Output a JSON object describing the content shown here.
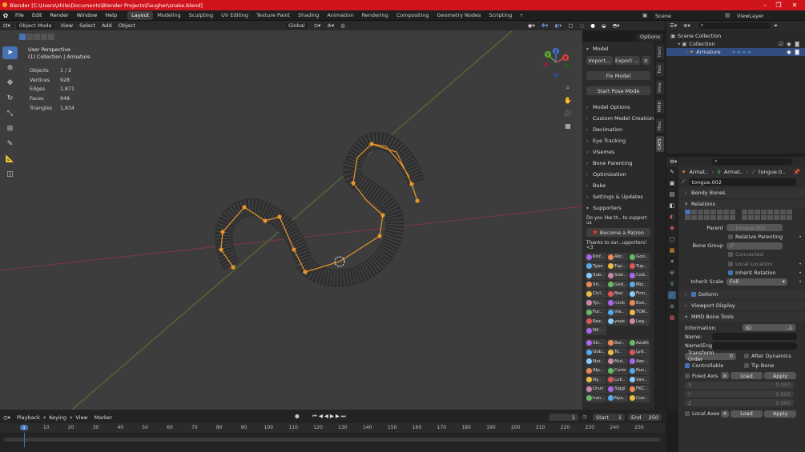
{
  "app": {
    "title": "Blender [C:\\Users\\zhile\\Documents\\Blender Projects\\Faugher\\snake.blend]"
  },
  "menu": [
    "File",
    "Edit",
    "Render",
    "Window",
    "Help"
  ],
  "workspaces": [
    "Layout",
    "Modeling",
    "Sculpting",
    "UV Editing",
    "Texture Paint",
    "Shading",
    "Animation",
    "Rendering",
    "Compositing",
    "Geometry Nodes",
    "Scripting"
  ],
  "active_workspace": "Layout",
  "scene": "Scene",
  "view_layer": "ViewLayer",
  "viewport": {
    "mode": "Object Mode",
    "menus": [
      "View",
      "Select",
      "Add",
      "Object"
    ],
    "orientation": "Global",
    "options": "Options",
    "title": "User Perspective",
    "context": "(1) Collection | Armature",
    "stats": [
      {
        "k": "Objects",
        "v": "1 / 2"
      },
      {
        "k": "Vertices",
        "v": "928"
      },
      {
        "k": "Edges",
        "v": "1,871"
      },
      {
        "k": "Faces",
        "v": "948"
      },
      {
        "k": "Triangles",
        "v": "1,834"
      }
    ]
  },
  "gizmo": {
    "x": "X",
    "y": "Y",
    "z": "Z"
  },
  "npanel": {
    "model_header": "Model",
    "import": "Import...",
    "export": "Export ...",
    "fix_model": "Fix Model",
    "start_pose": "Start Pose Mode",
    "sections": [
      "Model Options",
      "Custom Model Creation",
      "Decimation",
      "Eye Tracking",
      "Visemes",
      "Bone Parenting",
      "Optimization",
      "Bake",
      "Settings & Updates"
    ],
    "supporters_header": "Supporters",
    "support_text": "Do you like th.. to support us",
    "patron": "Become a Patron",
    "thanks": "Thanks to our...upporters! <3",
    "supporters1": [
      "Kric..",
      "Abr..",
      "Goo..",
      "Typo",
      "Tup..",
      "Tup..",
      "Sub..",
      "Sret..",
      "Cod..",
      "Sri..",
      "God..",
      "Miz..",
      "Cicl..",
      "Bee",
      "Finn..",
      "Tyr..",
      "n1ck",
      "Eve..",
      "Fur..",
      "Via..",
      "TOR..",
      "Rez..",
      "yeas",
      "Leg..",
      "Nil.."
    ],
    "supporters2": [
      "Str..",
      "Ber..",
      "Azuth",
      "Gob..",
      "To..",
      "Lyd..",
      "Nar..",
      "Mut..",
      "Awr..",
      "Alp..",
      "Curio",
      "Run..",
      "Ny..",
      "Luk..",
      "Van..",
      "Lhun",
      "Siggi",
      "FKC..",
      "hon..",
      "Nya..",
      "Coo.."
    ],
    "tabs": [
      "Item",
      "Tool",
      "View",
      "MMD",
      "Misc",
      "CATS"
    ]
  },
  "outliner": {
    "items": [
      "Scene Collection",
      "Collection",
      "Armature"
    ]
  },
  "properties": {
    "breadcrumb": [
      "Armat..",
      "Armat..",
      "tongue.0.."
    ],
    "bone_name": "tongue.002",
    "bendy": "Bendy Bones",
    "relations": "Relations",
    "parent_label": "Parent",
    "parent_value": "tongue.001",
    "relative_parenting": "Relative Parenting",
    "bone_group": "Bone Group",
    "connected": "Connected",
    "local_location": "Local Location",
    "inherit_rotation": "Inherit Rotation",
    "inherit_scale_label": "Inherit Scale",
    "inherit_scale_value": "Full",
    "deform": "Deform",
    "viewport_display": "Viewport Display",
    "mmd_tools": "MMD Bone Tools",
    "information_label": "Information:",
    "id_label": "ID",
    "id_value": "-1",
    "name_label": "Name:",
    "name_eng_label": "Name(Eng):",
    "transform_order_label": "Transform Order",
    "transform_order_value": "0",
    "after_dynamics": "After Dynamics",
    "controllable": "Controllable",
    "tip_bone": "Tip Bone",
    "fixed_axis": "Fixed Axis",
    "load": "Load",
    "apply": "Apply",
    "x": "X",
    "y": "Y",
    "z": "Z",
    "zero": "0.000",
    "local_axes": "Local Axes"
  },
  "timeline": {
    "menus": [
      "Playback",
      "Keying",
      "View",
      "Marker"
    ],
    "current": "1",
    "start_label": "Start",
    "start": "1",
    "end_label": "End",
    "end": "250",
    "ticks": [
      "1",
      "10",
      "20",
      "30",
      "40",
      "50",
      "60",
      "70",
      "80",
      "90",
      "100",
      "110",
      "120",
      "130",
      "140",
      "150",
      "160",
      "170",
      "180",
      "190",
      "200",
      "210",
      "220",
      "230",
      "240",
      "250"
    ]
  }
}
